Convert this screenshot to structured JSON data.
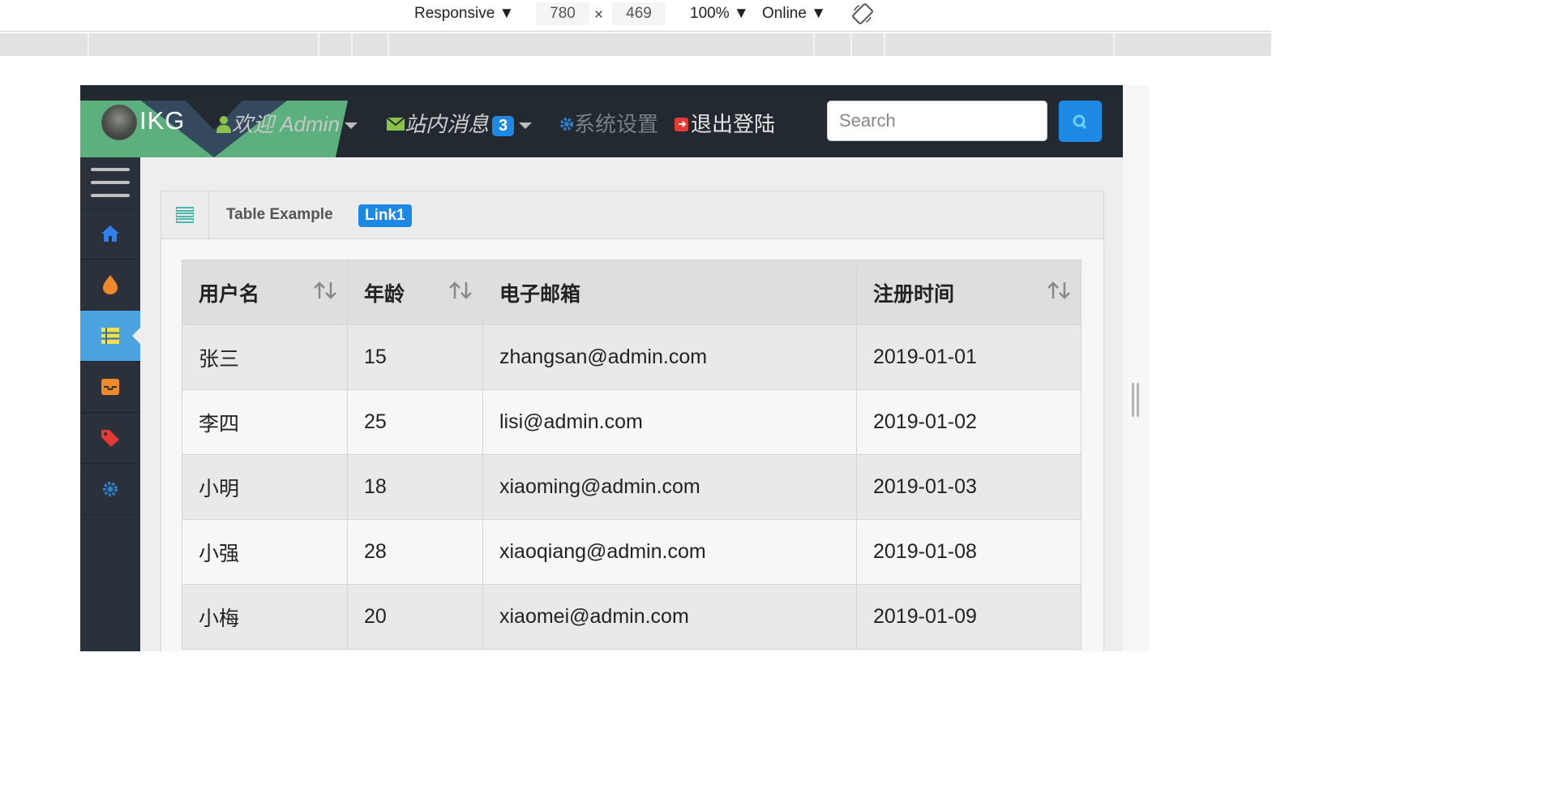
{
  "devtools": {
    "device": "Responsive ▼",
    "width": "780",
    "times": "×",
    "height": "469",
    "zoom": "100% ▼",
    "network": "Online ▼",
    "rotate_icon": "rotate-icon"
  },
  "app": {
    "brand": "IKG",
    "nav": {
      "welcome": "欢迎 Admin",
      "messages": "站内消息",
      "messages_count": "3",
      "settings": "系统设置",
      "logout": "退出登陆"
    },
    "search": {
      "placeholder": "Search"
    },
    "sidebar": [
      "menu-icon",
      "home-icon",
      "fire-icon",
      "table-icon",
      "inbox-icon",
      "tag-icon",
      "gear-icon"
    ],
    "panel": {
      "title": "Table Example",
      "link": "Link1"
    },
    "table": {
      "headers": [
        "用户名",
        "年龄",
        "电子邮箱",
        "注册时间"
      ],
      "rows": [
        [
          "张三",
          "15",
          "zhangsan@admin.com",
          "2019-01-01"
        ],
        [
          "李四",
          "25",
          "lisi@admin.com",
          "2019-01-02"
        ],
        [
          "小明",
          "18",
          "xiaoming@admin.com",
          "2019-01-03"
        ],
        [
          "小强",
          "28",
          "xiaoqiang@admin.com",
          "2019-01-08"
        ],
        [
          "小梅",
          "20",
          "xiaomei@admin.com",
          "2019-01-09"
        ]
      ]
    }
  },
  "colors": {
    "accent": "#1e88e5",
    "topbar": "#232931",
    "sidebar": "#2a313a",
    "sidebar_active": "#4aa3df",
    "logo_green": "#5fb783"
  }
}
